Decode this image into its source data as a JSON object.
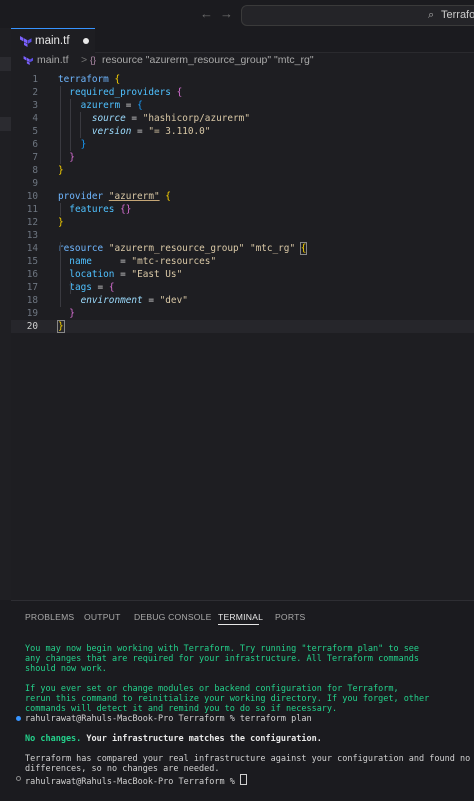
{
  "titlebar": {
    "back_glyph": "←",
    "forward_glyph": "→",
    "command_center_text": "Terraform",
    "search_glyph": "⌕"
  },
  "tab": {
    "label": "main.tf",
    "icon": "terraform-icon"
  },
  "breadcrumb": {
    "file": "main.tf",
    "separator": ">",
    "resource_icon": "{}",
    "resource": "resource \"azurerm_resource_group\" \"mtc_rg\""
  },
  "editor": {
    "line_numbers": [
      "1",
      "2",
      "3",
      "4",
      "5",
      "6",
      "7",
      "8",
      "9",
      "10",
      "11",
      "12",
      "13",
      "14",
      "15",
      "16",
      "17",
      "18",
      "19",
      "20"
    ],
    "lines": [
      "terraform {",
      "  required_providers {",
      "    azurerm = {",
      "      source = \"hashicorp/azurerm\"",
      "      version = \"= 3.110.0\"",
      "    }",
      "  }",
      "}",
      "",
      "provider \"azurerm\" {",
      "  features {}",
      "}",
      "",
      "resource \"azurerm_resource_group\" \"mtc_rg\" {",
      "  name     = \"mtc-resources\"",
      "  location = \"East Us\"",
      "  tags = {",
      "    environment = \"dev\"",
      "  }",
      "}"
    ]
  },
  "panel": {
    "tabs": [
      "PROBLEMS",
      "OUTPUT",
      "DEBUG CONSOLE",
      "TERMINAL",
      "PORTS"
    ],
    "active_tab": "TERMINAL"
  },
  "terminal": {
    "init_msg": [
      "You may now begin working with Terraform. Try running \"terraform plan\" to see",
      "any changes that are required for your infrastructure. All Terraform commands",
      "should now work.",
      "",
      "If you ever set or change modules or backend configuration for Terraform,",
      "rerun this command to reinitialize your working directory. If you forget, other",
      "commands will detect it and remind you to do so if necessary."
    ],
    "prompt1": "rahulrawat@Rahuls-MacBook-Pro Terraform % terraform plan",
    "no_changes_bold": "No changes.",
    "no_changes_rest": " Your infrastructure matches the configuration.",
    "compared_msg": [
      "Terraform has compared your real infrastructure against your configuration and found no",
      "differences, so no changes are needed."
    ],
    "prompt2": "rahulrawat@Rahuls-MacBook-Pro Terraform % "
  },
  "colors": {
    "accent": "#3794ff",
    "terminal_green": "#23d18b",
    "background": "#1e1e22"
  }
}
